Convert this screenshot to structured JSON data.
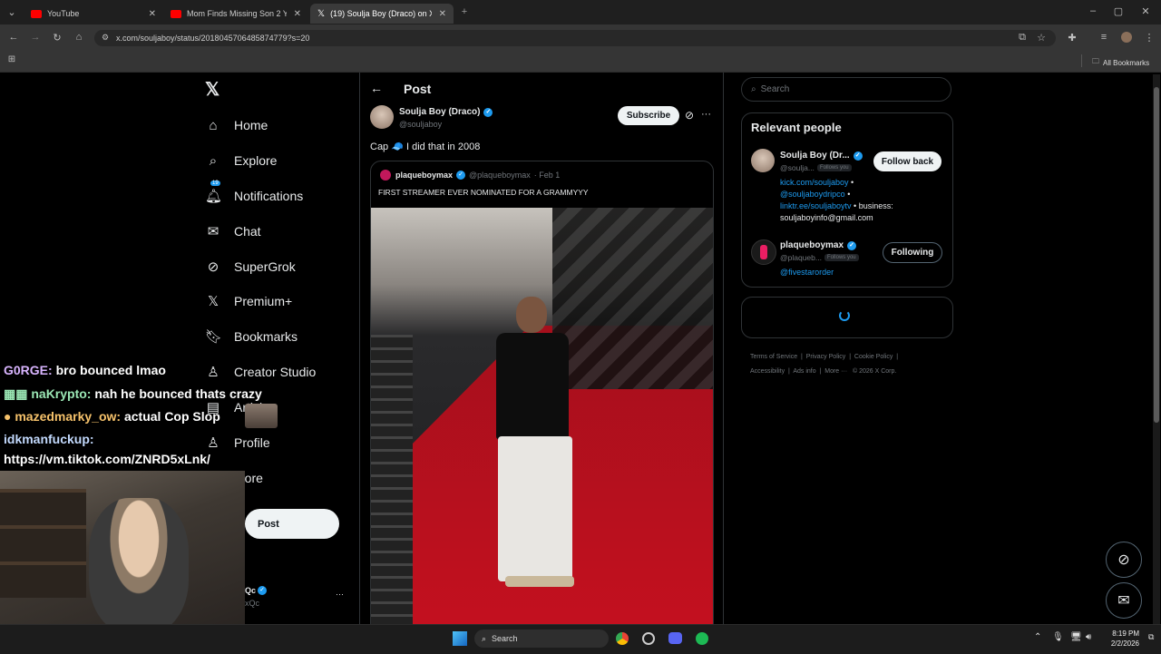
{
  "browser": {
    "tabs": [
      {
        "title": "YouTube",
        "icon": "youtube-icon",
        "color": "#ff0000"
      },
      {
        "title": "Mom Finds Missing Son 2 Y",
        "icon": "youtube-icon",
        "color": "#ff0000"
      },
      {
        "title": "(19) Soulja Boy (Draco) on X: \"C",
        "icon": "x-icon",
        "color": "#ffffff"
      }
    ],
    "url": "x.com/souljaboy/status/2018045706485874779?s=20",
    "all_bookmarks": "All Bookmarks"
  },
  "nav": {
    "items": [
      {
        "label": "Home",
        "icon": "home-icon"
      },
      {
        "label": "Explore",
        "icon": "search-icon"
      },
      {
        "label": "Notifications",
        "icon": "bell-icon",
        "badge": "19"
      },
      {
        "label": "Chat",
        "icon": "mail-icon"
      },
      {
        "label": "SuperGrok",
        "icon": "grok-icon"
      },
      {
        "label": "Premium+",
        "icon": "x-icon"
      },
      {
        "label": "Bookmarks",
        "icon": "bookmark-icon"
      },
      {
        "label": "Creator Studio",
        "icon": "creator-icon"
      },
      {
        "label": "Articles",
        "icon": "article-icon"
      },
      {
        "label": "Profile",
        "icon": "person-icon"
      },
      {
        "label": "More",
        "icon": "more-circle-icon"
      }
    ],
    "post_button": "Post",
    "account_name": "Qc",
    "account_handle": "xQc"
  },
  "post_header": {
    "back": "←",
    "title": "Post"
  },
  "post": {
    "author_name": "Soulja Boy (Draco)",
    "author_handle": "@souljaboy",
    "subscribe": "Subscribe",
    "text": "Cap 🧢 I did that in 2008",
    "quote": {
      "author_name": "plaqueboymax",
      "author_handle": "@plaqueboymax",
      "date": "· Feb 1",
      "text": "FIRST STREAMER EVER NOMINATED FOR A GRAMMYYY"
    }
  },
  "right": {
    "search_placeholder": "Search",
    "relevant_title": "Relevant people",
    "people": [
      {
        "name": "Soulja Boy (Dr...",
        "handle": "@soulja...",
        "follows_you": "Follows you",
        "button": "Follow back",
        "bio_links": [
          "kick.com/souljaboy",
          "@souljaboydripco",
          "linktr.ee/souljaboytv"
        ],
        "bio_text": "business: souljaboyinfo@gmail.com"
      },
      {
        "name": "plaqueboymax",
        "handle": "@plaqueb...",
        "follows_you": "Follows you",
        "button": "Following",
        "bio_links": [
          "@fivestarorder"
        ]
      }
    ],
    "footer_line1": [
      "Terms of Service",
      "Privacy Policy",
      "Cookie Policy"
    ],
    "footer_line2": [
      "Accessibility",
      "Ads info",
      "More ···",
      "© 2026 X Corp."
    ]
  },
  "chat": {
    "lines": [
      {
        "user": "G0RGE:",
        "user_color": "#d8b4fe",
        "message": "bro bounced lmao"
      },
      {
        "user": "naKrypto:",
        "user_color": "#9ae6b4",
        "message": "nah he bounced thats crazy"
      },
      {
        "user": "mazedmarky_ow:",
        "user_color": "#f6c26b",
        "message": "actual Cop Slop"
      },
      {
        "user": "idkmanfuckup:",
        "user_color": "#c3dafe",
        "message": "https://vm.tiktok.com/ZNRD5xLnk/"
      }
    ]
  },
  "taskbar": {
    "search": "Search",
    "time": "8:19 PM",
    "date": "2/2/2026"
  }
}
